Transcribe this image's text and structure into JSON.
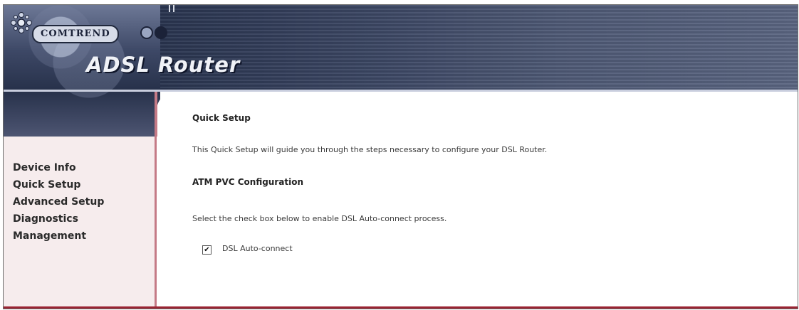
{
  "header": {
    "brand": "COMTREND",
    "product": "ADSL Router"
  },
  "sidebar": {
    "items": [
      {
        "label": "Device Info"
      },
      {
        "label": "Quick Setup"
      },
      {
        "label": "Advanced Setup"
      },
      {
        "label": "Diagnostics"
      },
      {
        "label": "Management"
      }
    ]
  },
  "main": {
    "title": "Quick Setup",
    "intro": "This Quick Setup will guide you through the steps necessary to configure your DSL Router.",
    "section_heading": "ATM PVC Configuration",
    "instruction": "Select the check box below to enable DSL Auto-connect process.",
    "checkbox": {
      "label": "DSL Auto-connect",
      "checked": true,
      "mark": "✔"
    }
  },
  "colors": {
    "accent": "#9a2433",
    "sidebar_bg": "#f6eced",
    "banner_dark": "#1a2336"
  }
}
